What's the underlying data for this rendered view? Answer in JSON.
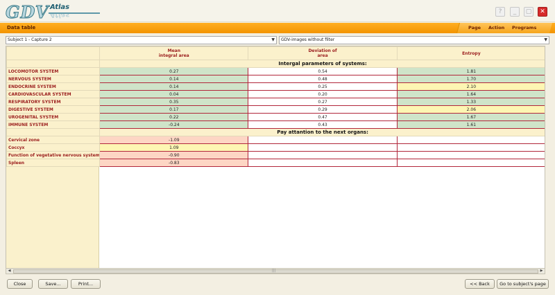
{
  "app": {
    "logo_text": "GDV",
    "logo_sub": "Atlas",
    "window_controls": [
      "help-icon",
      "minimize-icon",
      "maximize-icon",
      "close-icon"
    ]
  },
  "header": {
    "title": "Data table",
    "menu": [
      "Page",
      "Action",
      "Programs"
    ]
  },
  "filters": {
    "subject_select": "Subject 1 - Capture 2",
    "image_filter_select": "GDV-images without filter"
  },
  "table": {
    "columns": [
      "Mean\nintegral area",
      "Deviation of\narea",
      "Entropy"
    ],
    "section1_title": "Intergal parameters of systems:",
    "systems": [
      {
        "name": "LOCOMOTOR SYSTEM",
        "mean": "0.27",
        "dev": "0.54",
        "entropy": "1.81",
        "mean_status": "green",
        "dev_status": "white",
        "entropy_status": "green"
      },
      {
        "name": "NERVOUS SYSTEM",
        "mean": "0.14",
        "dev": "0.48",
        "entropy": "1.70",
        "mean_status": "green",
        "dev_status": "white",
        "entropy_status": "green"
      },
      {
        "name": "ENDOCRINE SYSTEM",
        "mean": "0.14",
        "dev": "0.25",
        "entropy": "2.10",
        "mean_status": "green",
        "dev_status": "white",
        "entropy_status": "yellow"
      },
      {
        "name": "CARDIOVASCULAR SYSTEM",
        "mean": "0.04",
        "dev": "0.20",
        "entropy": "1.64",
        "mean_status": "green",
        "dev_status": "white",
        "entropy_status": "green"
      },
      {
        "name": "RESPIRATORY SYSTEM",
        "mean": "0.35",
        "dev": "0.27",
        "entropy": "1.33",
        "mean_status": "green",
        "dev_status": "white",
        "entropy_status": "green"
      },
      {
        "name": "DIGESTIVE SYSTEM",
        "mean": "0.17",
        "dev": "0.29",
        "entropy": "2.06",
        "mean_status": "green",
        "dev_status": "white",
        "entropy_status": "yellow"
      },
      {
        "name": "UROGENITAL SYSTEM",
        "mean": "0.22",
        "dev": "0.47",
        "entropy": "1.67",
        "mean_status": "green",
        "dev_status": "white",
        "entropy_status": "green"
      },
      {
        "name": "IMMUNE SYSTEM",
        "mean": "-0.24",
        "dev": "0.43",
        "entropy": "1.61",
        "mean_status": "green",
        "dev_status": "white",
        "entropy_status": "green"
      }
    ],
    "section2_title": "Pay attantion to the next organs:",
    "organs": [
      {
        "name": "Cervical zone",
        "mean": "-1.09",
        "mean_status": "pink"
      },
      {
        "name": "Coccyx",
        "mean": "1.09",
        "mean_status": "yellow"
      },
      {
        "name": "Function of vegetative nervous system",
        "mean": "-0.90",
        "mean_status": "pink"
      },
      {
        "name": "Spleen",
        "mean": "-0.83",
        "mean_status": "pink"
      }
    ]
  },
  "scrollbar": {
    "grip": "|||"
  },
  "footer": {
    "close": "Close",
    "save": "Save...",
    "print": "Print...",
    "back": "<< Back",
    "subject_page": "Go to subject's page"
  },
  "colors": {
    "accent_orange": "#f39400",
    "label_red": "#9a1c1c",
    "green_cell": "#cfe4c9",
    "yellow_cell": "#fdf6b3",
    "pink_cell": "#fdd6c4"
  }
}
